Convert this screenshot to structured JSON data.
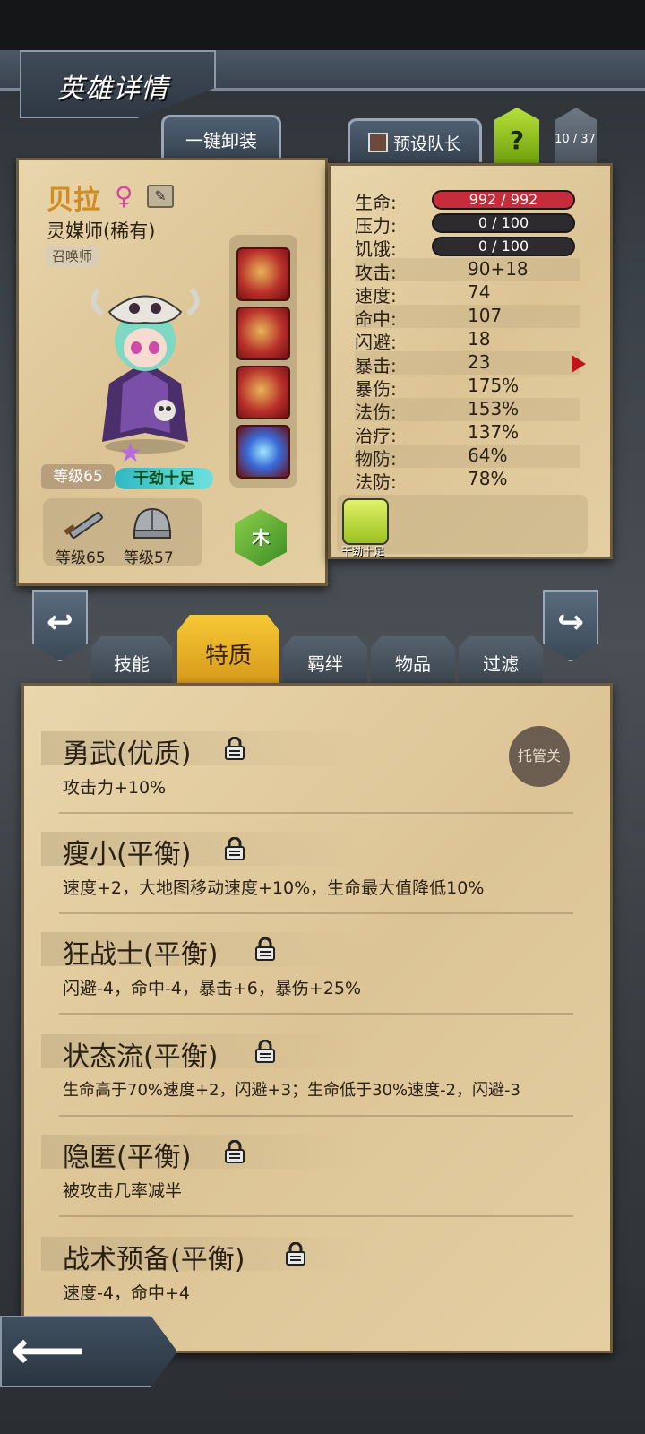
{
  "header": {
    "title": "英雄详情"
  },
  "top_buttons": {
    "unequip_label": "一键卸装",
    "preset_captain_label": "预设队长",
    "help_label": "?",
    "hero_count": "10 / 37"
  },
  "hero": {
    "name": "贝拉",
    "gender_symbol": "♀",
    "class_title": "灵媒师(稀有)",
    "role": "召唤师",
    "level": "等级65",
    "star_level": "★",
    "mood": "干劲十足",
    "weapon_level": "等级65",
    "armor_level": "等级57",
    "element": "木"
  },
  "stats": {
    "hp_label": "生命:",
    "hp": "992 / 992",
    "stress_label": "压力:",
    "stress": "0 / 100",
    "hunger_label": "饥饿:",
    "hunger": "0 / 100",
    "rows": [
      {
        "label": "攻击:",
        "value": "90+18"
      },
      {
        "label": "速度:",
        "value": "74"
      },
      {
        "label": "命中:",
        "value": "107"
      },
      {
        "label": "闪避:",
        "value": "18"
      },
      {
        "label": "暴击:",
        "value": "23"
      },
      {
        "label": "暴伤:",
        "value": "175%"
      },
      {
        "label": "法伤:",
        "value": "153%"
      },
      {
        "label": "治疗:",
        "value": "137%"
      },
      {
        "label": "物防:",
        "value": "64%"
      },
      {
        "label": "法防:",
        "value": "78%"
      }
    ],
    "status_label": "干劲十足"
  },
  "tabs": [
    "技能",
    "特质",
    "羁绊",
    "物品",
    "过滤"
  ],
  "active_tab": "特质",
  "auto_toggle_label": "托管关",
  "traits": [
    {
      "name": "勇武(优质)",
      "desc": "攻击力+10%"
    },
    {
      "name": "瘦小(平衡)",
      "desc": "速度+2，大地图移动速度+10%，生命最大值降低10%"
    },
    {
      "name": "狂战士(平衡)",
      "desc": "闪避-4，命中-4，暴击+6，暴伤+25%"
    },
    {
      "name": "状态流(平衡)",
      "desc": "生命高于70%速度+2，闪避+3；生命低于30%速度-2，闪避-3"
    },
    {
      "name": "隐匿(平衡)",
      "desc": "被攻击几率减半"
    },
    {
      "name": "战术预备(平衡)",
      "desc": "速度-4，命中+4"
    }
  ],
  "colors": {
    "accent_tab": "#f7c834",
    "hp_bar": "#c52c3c",
    "element": "#5bb030"
  }
}
